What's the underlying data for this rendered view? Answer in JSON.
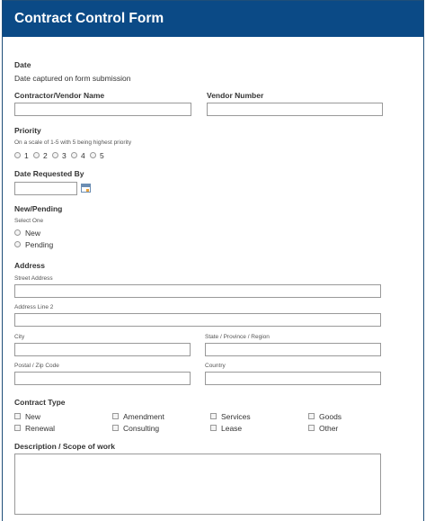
{
  "header": {
    "title": "Contract Control Form"
  },
  "date": {
    "label": "Date",
    "text": "Date captured on form submission"
  },
  "contractor": {
    "label": "Contractor/Vendor Name",
    "value": ""
  },
  "vendor_number": {
    "label": "Vendor Number",
    "value": ""
  },
  "priority": {
    "label": "Priority",
    "hint": "On a scale of 1-5 with 5 being highest priority",
    "options": [
      "1",
      "2",
      "3",
      "4",
      "5"
    ]
  },
  "date_requested": {
    "label": "Date Requested By",
    "value": ""
  },
  "new_pending": {
    "label": "New/Pending",
    "hint": "Select One",
    "options": [
      "New",
      "Pending"
    ]
  },
  "address": {
    "label": "Address",
    "street_label": "Street Address",
    "line2_label": "Address Line 2",
    "city_label": "City",
    "state_label": "State / Province / Region",
    "zip_label": "Postal / Zip Code",
    "country_label": "Country"
  },
  "contract_type": {
    "label": "Contract Type",
    "options": [
      "New",
      "Amendment",
      "Services",
      "Goods",
      "Renewal",
      "Consulting",
      "Lease",
      "Other"
    ]
  },
  "description": {
    "label": "Description / Scope of work",
    "value": ""
  }
}
